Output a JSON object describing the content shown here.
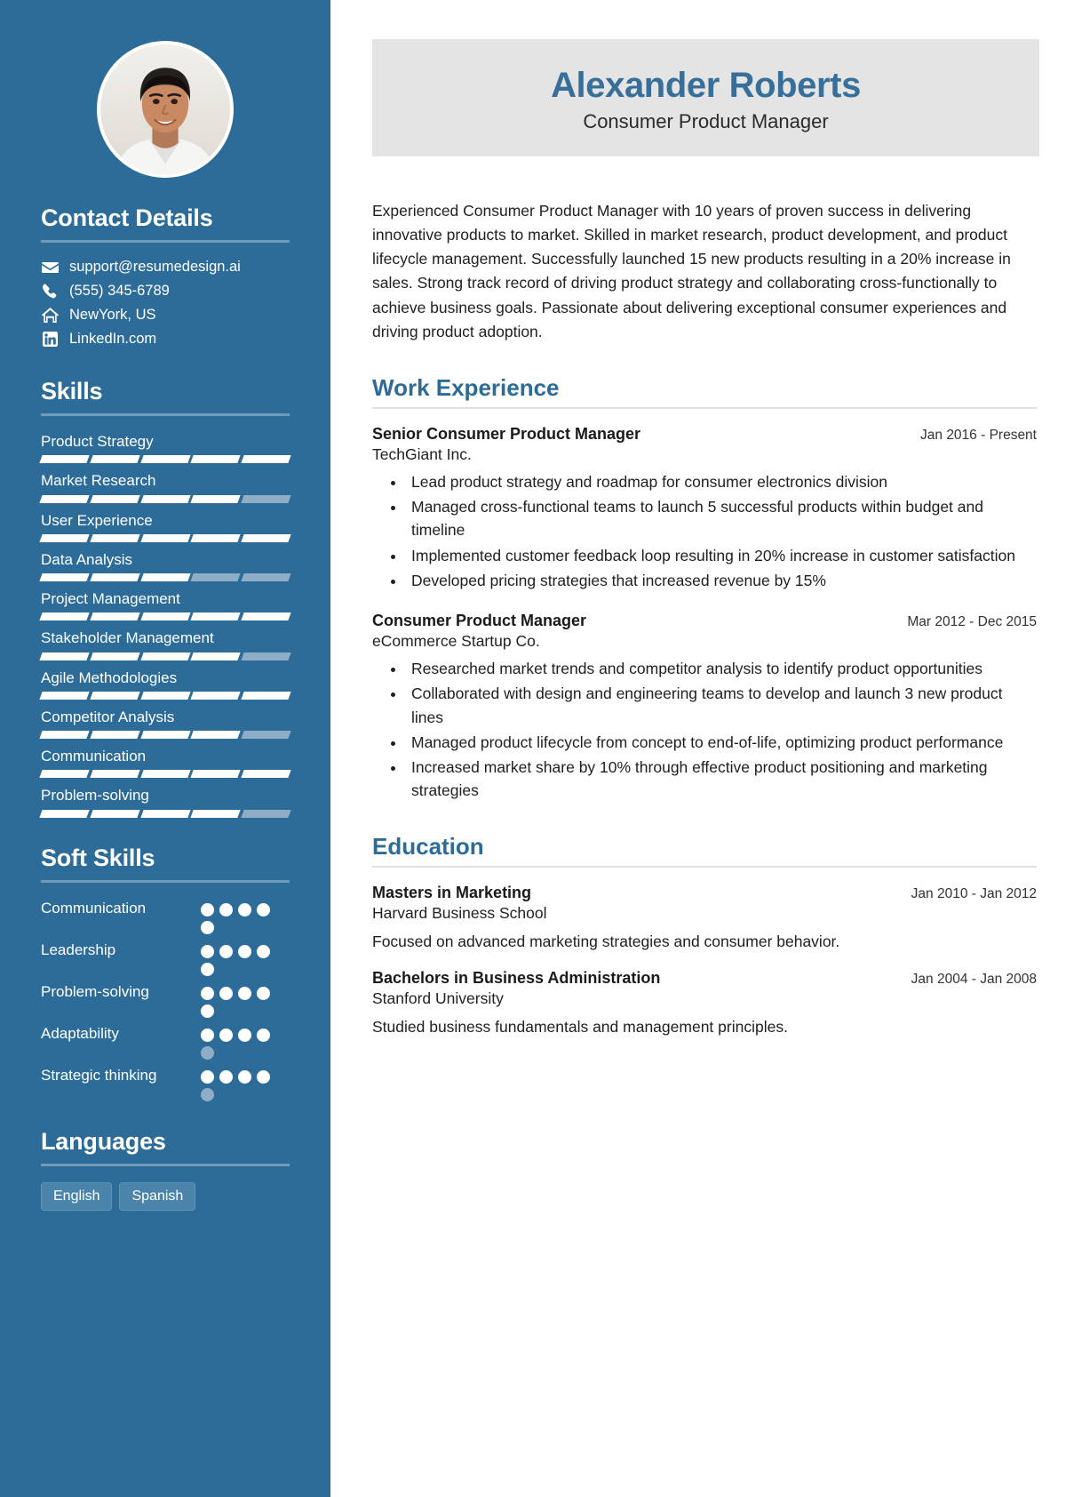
{
  "header": {
    "name": "Alexander Roberts",
    "job_title": "Consumer Product Manager"
  },
  "sidebar": {
    "contact": {
      "heading": "Contact Details",
      "items": [
        {
          "icon": "envelope-icon",
          "value": "support@resumedesign.ai"
        },
        {
          "icon": "phone-icon",
          "value": "(555) 345-6789"
        },
        {
          "icon": "home-icon",
          "value": "NewYork, US"
        },
        {
          "icon": "linkedin-icon",
          "value": "LinkedIn.com"
        }
      ]
    },
    "skills": {
      "heading": "Skills",
      "max": 5,
      "items": [
        {
          "name": "Product Strategy",
          "level": 5
        },
        {
          "name": "Market Research",
          "level": 4
        },
        {
          "name": "User Experience",
          "level": 5
        },
        {
          "name": "Data Analysis",
          "level": 3
        },
        {
          "name": "Project Management",
          "level": 5
        },
        {
          "name": "Stakeholder Management",
          "level": 4
        },
        {
          "name": "Agile Methodologies",
          "level": 5
        },
        {
          "name": "Competitor Analysis",
          "level": 4
        },
        {
          "name": "Communication",
          "level": 5
        },
        {
          "name": "Problem-solving",
          "level": 4
        }
      ]
    },
    "soft_skills": {
      "heading": "Soft Skills",
      "max": 5,
      "items": [
        {
          "name": "Communication",
          "level": 5
        },
        {
          "name": "Leadership",
          "level": 5
        },
        {
          "name": "Problem-solving",
          "level": 5
        },
        {
          "name": "Adaptability",
          "level": 4
        },
        {
          "name": "Strategic thinking",
          "level": 4
        }
      ]
    },
    "languages": {
      "heading": "Languages",
      "items": [
        "English",
        "Spanish"
      ]
    }
  },
  "main": {
    "summary": "Experienced Consumer Product Manager with 10 years of proven success in delivering innovative products to market. Skilled in market research, product development, and product lifecycle management. Successfully launched 15 new products resulting in a 20% increase in sales. Strong track record of driving product strategy and collaborating cross-functionally to achieve business goals. Passionate about delivering exceptional consumer experiences and driving product adoption.",
    "work_experience": {
      "heading": "Work Experience",
      "entries": [
        {
          "title": "Senior Consumer Product Manager",
          "organization": "TechGiant Inc.",
          "date": "Jan 2016 - Present",
          "bullets": [
            "Lead product strategy and roadmap for consumer electronics division",
            "Managed cross-functional teams to launch 5 successful products within budget and timeline",
            "Implemented customer feedback loop resulting in 20% increase in customer satisfaction",
            "Developed pricing strategies that increased revenue by 15%"
          ]
        },
        {
          "title": "Consumer Product Manager",
          "organization": "eCommerce Startup Co.",
          "date": "Mar 2012 - Dec 2015",
          "bullets": [
            "Researched market trends and competitor analysis to identify product opportunities",
            "Collaborated with design and engineering teams to develop and launch 3 new product lines",
            "Managed product lifecycle from concept to end-of-life, optimizing product performance",
            "Increased market share by 10% through effective product positioning and marketing strategies"
          ]
        }
      ]
    },
    "education": {
      "heading": "Education",
      "entries": [
        {
          "title": "Masters in Marketing",
          "organization": "Harvard Business School",
          "date": "Jan 2010 - Jan 2012",
          "description": "Focused on advanced marketing strategies and consumer behavior."
        },
        {
          "title": "Bachelors in Business Administration",
          "organization": "Stanford University",
          "date": "Jan 2004 - Jan 2008",
          "description": "Studied business fundamentals and management principles."
        }
      ]
    }
  },
  "colors": {
    "sidebar_bg": "#2d6c99",
    "accent": "#2d6c99",
    "name_color": "#376f99",
    "banner_bg": "#e4e4e4",
    "bar_off": "#8eaec7"
  }
}
